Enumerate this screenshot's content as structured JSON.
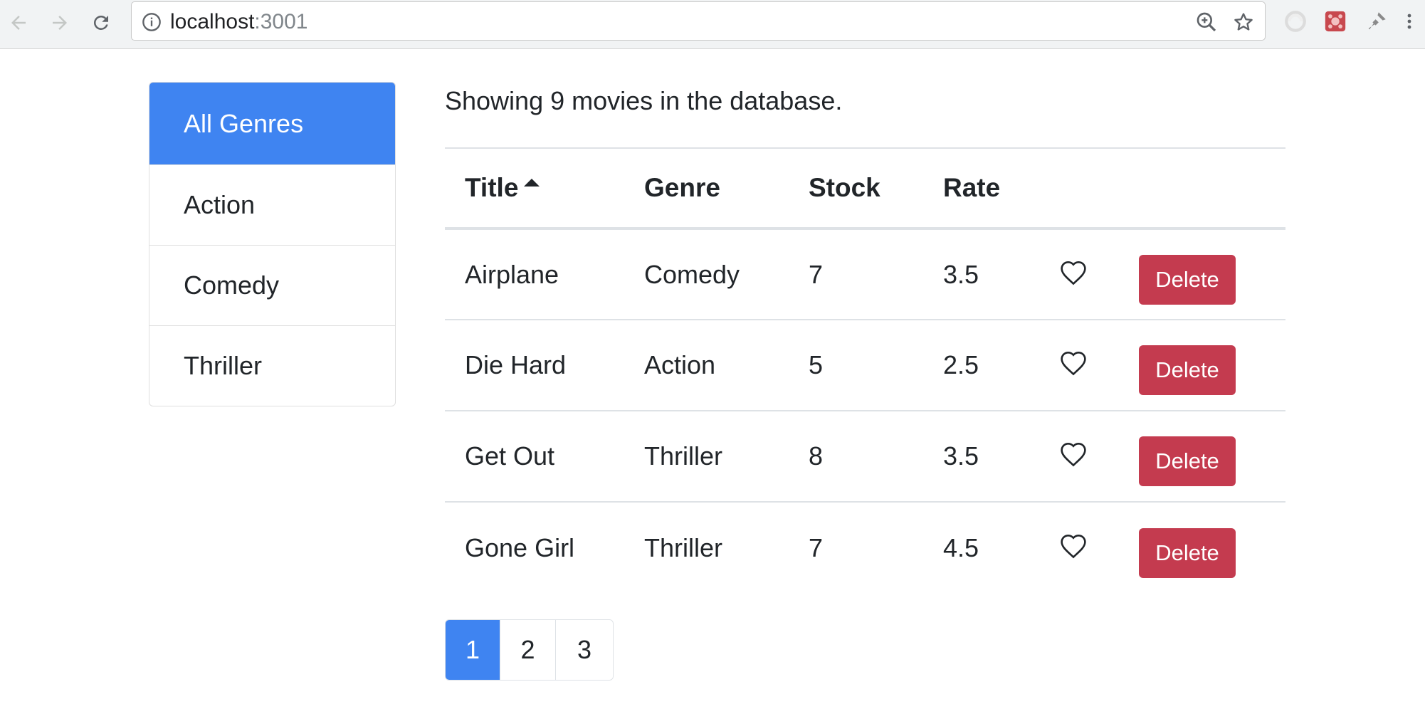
{
  "browser": {
    "url_host": "localhost",
    "url_port": ":3001",
    "icons": [
      "back-arrow-icon",
      "forward-arrow-icon",
      "reload-icon",
      "info-icon",
      "zoom-icon",
      "star-icon",
      "extension-icon",
      "extension-icon",
      "extension-icon",
      "menu-dots-icon"
    ]
  },
  "sidebar": {
    "items": [
      {
        "label": "All Genres",
        "active": true
      },
      {
        "label": "Action",
        "active": false
      },
      {
        "label": "Comedy",
        "active": false
      },
      {
        "label": "Thriller",
        "active": false
      }
    ]
  },
  "main": {
    "summary": "Showing 9 movies in the database.",
    "table": {
      "headers": [
        "Title",
        "Genre",
        "Stock",
        "Rate"
      ],
      "sort_column": "Title",
      "sort_direction": "ascending",
      "rows": [
        {
          "title": "Airplane",
          "genre": "Comedy",
          "stock": "7",
          "rate": "3.5"
        },
        {
          "title": "Die Hard",
          "genre": "Action",
          "stock": "5",
          "rate": "2.5"
        },
        {
          "title": "Get Out",
          "genre": "Thriller",
          "stock": "8",
          "rate": "3.5"
        },
        {
          "title": "Gone Girl",
          "genre": "Thriller",
          "stock": "7",
          "rate": "4.5"
        }
      ],
      "delete_label": "Delete"
    },
    "pagination": {
      "pages": [
        "1",
        "2",
        "3"
      ],
      "active": "1"
    }
  },
  "colors": {
    "primary": "#3f84f1",
    "danger": "#c43b4f",
    "border": "#dee2e6"
  }
}
